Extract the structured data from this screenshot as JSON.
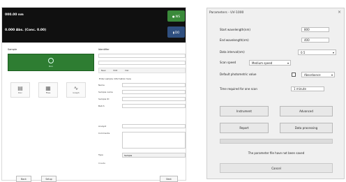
{
  "left_app": {
    "header": {
      "line1": "000.00 nm",
      "line2": "0.000 Abs. (Conc. 0.00)",
      "lamp_label": "WS",
      "battery_label": "DO"
    },
    "section_left_title": "Sample",
    "section_right_title": "Identifier",
    "run_button": {
      "label": "Run",
      "icon": "play-circle-icon"
    },
    "icon_buttons": [
      {
        "icon": "document-icon",
        "label": "Doc"
      },
      {
        "icon": "files-icon",
        "label": "Files"
      },
      {
        "icon": "chart-icon",
        "label": "Graph"
      }
    ],
    "toolbar": {
      "new": "New",
      "edit": "Edit",
      "delete": "Del"
    },
    "note": "Enter sample information here",
    "sample_labels": [
      "Name",
      "Sample name",
      "Sample ID",
      "Batch",
      "Analyst",
      "Comments"
    ],
    "type_label": "Type",
    "type_value": "Sample",
    "create_link": "Create",
    "bottom_buttons": [
      "Back",
      "Setup",
      "Next"
    ]
  },
  "dialog": {
    "title": "Parameters - UV-1000",
    "close_glyph": "×",
    "rows": [
      {
        "label": "Start wavelength(nm)",
        "value": "800"
      },
      {
        "label": "End wavelength(nm)",
        "value": "400"
      },
      {
        "label": "Data interval(nm)",
        "value": "0.5"
      },
      {
        "label": "Scan speed",
        "value": "Medium speed"
      },
      {
        "label": "Default photometric value",
        "value": "Absorbance"
      },
      {
        "label": "Time required for one scan",
        "value": "1 minute"
      }
    ],
    "buttons": [
      "Instrument",
      "Advanced",
      "Report",
      "Data processing"
    ],
    "progress_label": "",
    "message": "The parameter file have not been saved",
    "cancel_label": "Cancel"
  }
}
